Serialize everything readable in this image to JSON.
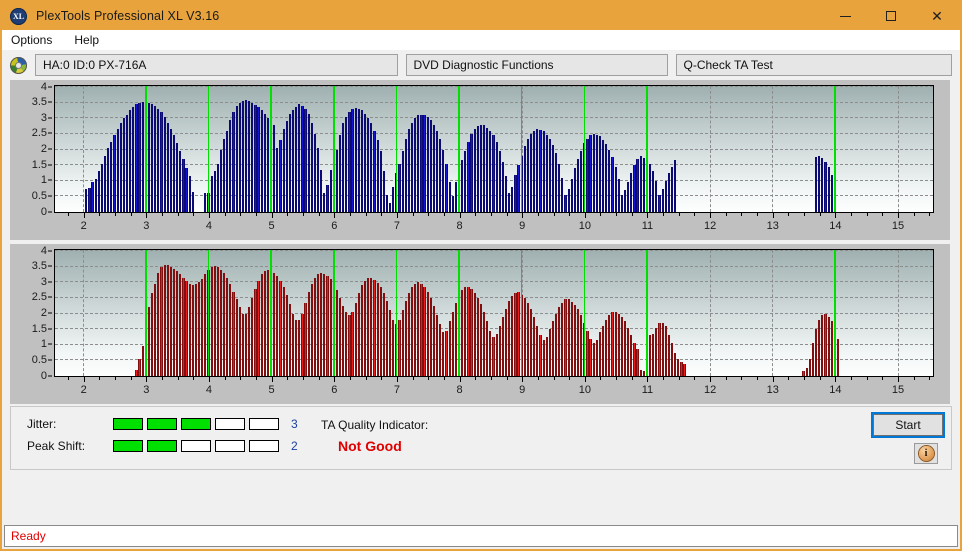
{
  "window": {
    "title": "PlexTools Professional XL V3.16",
    "app_icon": "XL",
    "controls": {
      "minimize": "minimize-icon",
      "maximize": "maximize-icon",
      "close": "close-icon"
    }
  },
  "menubar": {
    "items": [
      {
        "label": "Options"
      },
      {
        "label": "Help"
      }
    ]
  },
  "toolbar": {
    "drive_icon": "optical-disc-icon",
    "drive": "HA:0 ID:0  PX-716A",
    "function": "DVD Diagnostic Functions",
    "test": "Q-Check TA Test"
  },
  "indicators": {
    "jitter": {
      "label": "Jitter:",
      "value": "3",
      "filled": 3,
      "total": 5,
      "color": "#00e000"
    },
    "peak_shift": {
      "label": "Peak Shift:",
      "value": "2",
      "filled": 2,
      "total": 5,
      "color": "#00e000"
    },
    "ta_quality": {
      "label": "TA Quality Indicator:",
      "value": "Not Good",
      "color": "#e00000"
    },
    "start_button": "Start",
    "info_button": "i"
  },
  "statusbar": {
    "text": "Ready",
    "color": "#e00000"
  },
  "chart_data": [
    {
      "id": "ta-test-top",
      "type": "bar",
      "title": "",
      "xlabel": "",
      "ylabel": "",
      "color": "#1414d2",
      "xlim": [
        1.55,
        15.55
      ],
      "ylim": [
        0,
        4
      ],
      "yticks": [
        0,
        0.5,
        1,
        1.5,
        2,
        2.5,
        3,
        3.5,
        4
      ],
      "ytick_labels": [
        "0",
        "0.5",
        "1",
        "1.5",
        "2",
        "2.5",
        "3",
        "3.5",
        "4"
      ],
      "xticks": [
        2,
        3,
        4,
        5,
        6,
        7,
        8,
        9,
        10,
        11,
        12,
        13,
        14,
        15
      ],
      "xtick_labels": [
        "2",
        "3",
        "4",
        "5",
        "6",
        "7",
        "8",
        "9",
        "10",
        "11",
        "12",
        "13",
        "14",
        "15"
      ],
      "grid": true,
      "green_marker_x": [
        3,
        4,
        5,
        6,
        7,
        8,
        9,
        10,
        11,
        14
      ],
      "bar_width_x": 0.045,
      "x": [
        2.0,
        2.05,
        2.1,
        2.15,
        2.2,
        2.25,
        2.3,
        2.35,
        2.4,
        2.45,
        2.5,
        2.55,
        2.6,
        2.65,
        2.7,
        2.75,
        2.8,
        2.85,
        2.9,
        2.95,
        3.0,
        3.05,
        3.1,
        3.15,
        3.2,
        3.25,
        3.3,
        3.35,
        3.4,
        3.45,
        3.5,
        3.55,
        3.6,
        3.65,
        3.7,
        3.75,
        3.8,
        3.85,
        3.9,
        3.95,
        4.0,
        4.05,
        4.1,
        4.15,
        4.2,
        4.25,
        4.3,
        4.35,
        4.4,
        4.45,
        4.5,
        4.55,
        4.6,
        4.65,
        4.7,
        4.75,
        4.8,
        4.85,
        4.9,
        4.95,
        5.0,
        5.05,
        5.1,
        5.15,
        5.2,
        5.25,
        5.3,
        5.35,
        5.4,
        5.45,
        5.5,
        5.55,
        5.6,
        5.65,
        5.7,
        5.75,
        5.8,
        5.85,
        5.9,
        5.95,
        6.0,
        6.05,
        6.1,
        6.15,
        6.2,
        6.25,
        6.3,
        6.35,
        6.4,
        6.45,
        6.5,
        6.55,
        6.6,
        6.65,
        6.7,
        6.75,
        6.8,
        6.85,
        6.9,
        6.95,
        7.0,
        7.05,
        7.1,
        7.15,
        7.2,
        7.25,
        7.3,
        7.35,
        7.4,
        7.45,
        7.5,
        7.55,
        7.6,
        7.65,
        7.7,
        7.75,
        7.8,
        7.85,
        7.9,
        7.95,
        8.0,
        8.05,
        8.1,
        8.15,
        8.2,
        8.25,
        8.3,
        8.35,
        8.4,
        8.45,
        8.5,
        8.55,
        8.6,
        8.65,
        8.7,
        8.75,
        8.8,
        8.85,
        8.9,
        8.95,
        9.0,
        9.05,
        9.1,
        9.15,
        9.2,
        9.25,
        9.3,
        9.35,
        9.4,
        9.45,
        9.5,
        9.55,
        9.6,
        9.65,
        9.7,
        9.75,
        9.8,
        9.85,
        9.9,
        9.95,
        10.0,
        10.05,
        10.1,
        10.15,
        10.2,
        10.25,
        10.3,
        10.35,
        10.4,
        10.45,
        10.5,
        10.55,
        10.6,
        10.65,
        10.7,
        10.75,
        10.8,
        10.85,
        10.9,
        10.95,
        11.0,
        11.05,
        11.1,
        11.15,
        11.2,
        11.25,
        11.3,
        11.35,
        11.4,
        11.45,
        13.7,
        13.75,
        13.8,
        13.85,
        13.9,
        13.95,
        14.0,
        14.05,
        14.1,
        14.15,
        14.2,
        14.25,
        14.3
      ],
      "values": [
        0.0,
        0.75,
        0.78,
        0.95,
        1.05,
        1.3,
        1.55,
        1.8,
        2.05,
        2.25,
        2.45,
        2.65,
        2.85,
        3.0,
        3.12,
        3.25,
        3.35,
        3.45,
        3.5,
        3.52,
        3.52,
        3.48,
        3.45,
        3.4,
        3.3,
        3.2,
        3.05,
        2.85,
        2.65,
        2.45,
        2.2,
        1.95,
        1.7,
        1.4,
        1.15,
        0.65,
        0.0,
        0.0,
        0.0,
        0.6,
        0.62,
        1.15,
        1.3,
        1.55,
        2.0,
        2.35,
        2.6,
        2.95,
        3.2,
        3.4,
        3.48,
        3.55,
        3.58,
        3.55,
        3.5,
        3.42,
        3.35,
        3.25,
        3.15,
        3.0,
        3.0,
        2.8,
        2.05,
        2.3,
        2.65,
        2.9,
        3.15,
        3.25,
        3.35,
        3.45,
        3.4,
        3.3,
        3.15,
        2.85,
        2.5,
        2.05,
        1.35,
        0.6,
        0.85,
        1.35,
        1.65,
        2.0,
        2.45,
        2.85,
        3.05,
        3.2,
        3.3,
        3.32,
        3.3,
        3.25,
        3.15,
        3.0,
        2.85,
        2.6,
        2.3,
        1.95,
        1.3,
        0.55,
        0.3,
        0.8,
        1.25,
        1.55,
        1.95,
        2.35,
        2.65,
        2.85,
        3.0,
        3.1,
        3.12,
        3.1,
        3.05,
        2.95,
        2.8,
        2.6,
        2.35,
        2.0,
        1.55,
        0.95,
        0.5,
        0.95,
        1.3,
        1.65,
        1.95,
        2.25,
        2.5,
        2.65,
        2.75,
        2.8,
        2.78,
        2.7,
        2.6,
        2.45,
        2.25,
        1.95,
        1.6,
        1.15,
        0.6,
        0.8,
        1.2,
        1.5,
        1.8,
        2.1,
        2.35,
        2.5,
        2.6,
        2.65,
        2.63,
        2.58,
        2.48,
        2.35,
        2.15,
        1.9,
        1.55,
        1.1,
        0.55,
        0.75,
        1.05,
        1.4,
        1.7,
        1.95,
        2.2,
        2.35,
        2.45,
        2.5,
        2.48,
        2.42,
        2.32,
        2.18,
        2.0,
        1.75,
        1.45,
        1.05,
        0.55,
        0.7,
        0.95,
        1.25,
        1.5,
        1.7,
        1.8,
        1.72,
        1.65,
        1.55,
        1.3,
        1.0,
        0.55,
        0.75,
        1.0,
        1.25,
        1.45,
        1.65,
        1.75,
        1.78,
        1.72,
        1.6,
        1.45,
        1.2,
        0.85
      ],
      "gaps_note": "no data between x≈11.5 and x≈13.7, and no data after x≈14.3"
    },
    {
      "id": "ta-test-bottom",
      "type": "bar",
      "title": "",
      "xlabel": "",
      "ylabel": "",
      "color": "#ec1c1c",
      "xlim": [
        1.55,
        15.55
      ],
      "ylim": [
        0,
        4
      ],
      "yticks": [
        0,
        0.5,
        1,
        1.5,
        2,
        2.5,
        3,
        3.5,
        4
      ],
      "ytick_labels": [
        "0",
        "0.5",
        "1",
        "1.5",
        "2",
        "2.5",
        "3",
        "3.5",
        "4"
      ],
      "xticks": [
        2,
        3,
        4,
        5,
        6,
        7,
        8,
        9,
        10,
        11,
        12,
        13,
        14,
        15
      ],
      "xtick_labels": [
        "2",
        "3",
        "4",
        "5",
        "6",
        "7",
        "8",
        "9",
        "10",
        "11",
        "12",
        "13",
        "14",
        "15"
      ],
      "grid": true,
      "green_marker_x": [
        3,
        4,
        5,
        6,
        7,
        8,
        9,
        10,
        11,
        14
      ],
      "bar_width_x": 0.045,
      "x": [
        2.85,
        2.9,
        2.95,
        3.0,
        3.05,
        3.1,
        3.15,
        3.2,
        3.25,
        3.3,
        3.35,
        3.4,
        3.45,
        3.5,
        3.55,
        3.6,
        3.65,
        3.7,
        3.75,
        3.8,
        3.85,
        3.9,
        3.95,
        4.0,
        4.05,
        4.1,
        4.15,
        4.2,
        4.25,
        4.3,
        4.35,
        4.4,
        4.45,
        4.5,
        4.55,
        4.6,
        4.65,
        4.7,
        4.75,
        4.8,
        4.85,
        4.9,
        4.95,
        5.0,
        5.05,
        5.1,
        5.15,
        5.2,
        5.25,
        5.3,
        5.35,
        5.4,
        5.45,
        5.5,
        5.55,
        5.6,
        5.65,
        5.7,
        5.75,
        5.8,
        5.85,
        5.9,
        5.95,
        6.0,
        6.05,
        6.1,
        6.15,
        6.2,
        6.25,
        6.3,
        6.35,
        6.4,
        6.45,
        6.5,
        6.55,
        6.6,
        6.65,
        6.7,
        6.75,
        6.8,
        6.85,
        6.9,
        6.95,
        7.0,
        7.05,
        7.1,
        7.15,
        7.2,
        7.25,
        7.3,
        7.35,
        7.4,
        7.45,
        7.5,
        7.55,
        7.6,
        7.65,
        7.7,
        7.75,
        7.8,
        7.85,
        7.9,
        7.95,
        8.0,
        8.05,
        8.1,
        8.15,
        8.2,
        8.25,
        8.3,
        8.35,
        8.4,
        8.45,
        8.5,
        8.55,
        8.6,
        8.65,
        8.7,
        8.75,
        8.8,
        8.85,
        8.9,
        8.95,
        9.0,
        9.05,
        9.1,
        9.15,
        9.2,
        9.25,
        9.3,
        9.35,
        9.4,
        9.45,
        9.5,
        9.55,
        9.6,
        9.65,
        9.7,
        9.75,
        9.8,
        9.85,
        9.9,
        9.95,
        10.0,
        10.05,
        10.1,
        10.15,
        10.2,
        10.25,
        10.3,
        10.35,
        10.4,
        10.45,
        10.5,
        10.55,
        10.6,
        10.65,
        10.7,
        10.75,
        10.8,
        10.85,
        10.9,
        10.95,
        11.0,
        11.05,
        11.1,
        11.15,
        11.2,
        11.25,
        11.3,
        11.35,
        11.4,
        11.45,
        11.5,
        11.55,
        11.6,
        13.5,
        13.55,
        13.6,
        13.65,
        13.7,
        13.75,
        13.8,
        13.85,
        13.9,
        13.95,
        14.0,
        14.05
      ],
      "values": [
        0.2,
        0.55,
        0.95,
        1.5,
        2.2,
        2.65,
        2.95,
        3.3,
        3.5,
        3.55,
        3.55,
        3.48,
        3.42,
        3.35,
        3.25,
        3.15,
        3.05,
        2.95,
        2.9,
        2.95,
        3.0,
        3.1,
        3.25,
        3.4,
        3.5,
        3.52,
        3.48,
        3.4,
        3.3,
        3.15,
        2.95,
        2.7,
        2.45,
        2.2,
        2.0,
        2.0,
        2.2,
        2.5,
        2.8,
        3.05,
        3.25,
        3.35,
        3.38,
        3.35,
        3.3,
        3.2,
        3.05,
        2.85,
        2.6,
        2.3,
        2.0,
        1.8,
        1.8,
        2.0,
        2.35,
        2.7,
        2.95,
        3.15,
        3.25,
        3.3,
        3.28,
        3.2,
        3.1,
        2.95,
        2.75,
        2.5,
        2.25,
        2.05,
        1.95,
        2.05,
        2.35,
        2.65,
        2.9,
        3.05,
        3.15,
        3.15,
        3.08,
        2.98,
        2.85,
        2.65,
        2.4,
        2.1,
        1.8,
        1.65,
        1.8,
        2.1,
        2.4,
        2.65,
        2.85,
        2.95,
        3.0,
        2.95,
        2.85,
        2.7,
        2.5,
        2.25,
        1.95,
        1.65,
        1.4,
        1.45,
        1.75,
        2.05,
        2.35,
        2.6,
        2.75,
        2.85,
        2.85,
        2.78,
        2.65,
        2.5,
        2.3,
        2.05,
        1.75,
        1.45,
        1.25,
        1.35,
        1.6,
        1.9,
        2.15,
        2.4,
        2.55,
        2.65,
        2.68,
        2.6,
        2.5,
        2.35,
        2.15,
        1.9,
        1.6,
        1.3,
        1.15,
        1.25,
        1.5,
        1.75,
        2.0,
        2.2,
        2.35,
        2.45,
        2.45,
        2.38,
        2.28,
        2.15,
        1.95,
        1.7,
        1.45,
        1.2,
        1.05,
        1.15,
        1.4,
        1.6,
        1.8,
        1.95,
        2.05,
        2.05,
        1.98,
        1.88,
        1.75,
        1.55,
        1.3,
        1.05,
        0.85,
        0.2,
        0.15,
        1.25,
        1.3,
        1.35,
        1.55,
        1.7,
        1.7,
        1.6,
        1.3,
        1.05,
        0.75,
        0.55,
        0.45,
        0.4,
        0.15,
        0.25,
        0.55,
        1.05,
        1.5,
        1.8,
        1.95,
        2.0,
        1.9,
        1.75,
        1.55,
        1.2
      ],
      "gaps_note": "no data before x≈2.85, between x≈11.6 and x≈13.5, and after x≈14.05"
    }
  ]
}
